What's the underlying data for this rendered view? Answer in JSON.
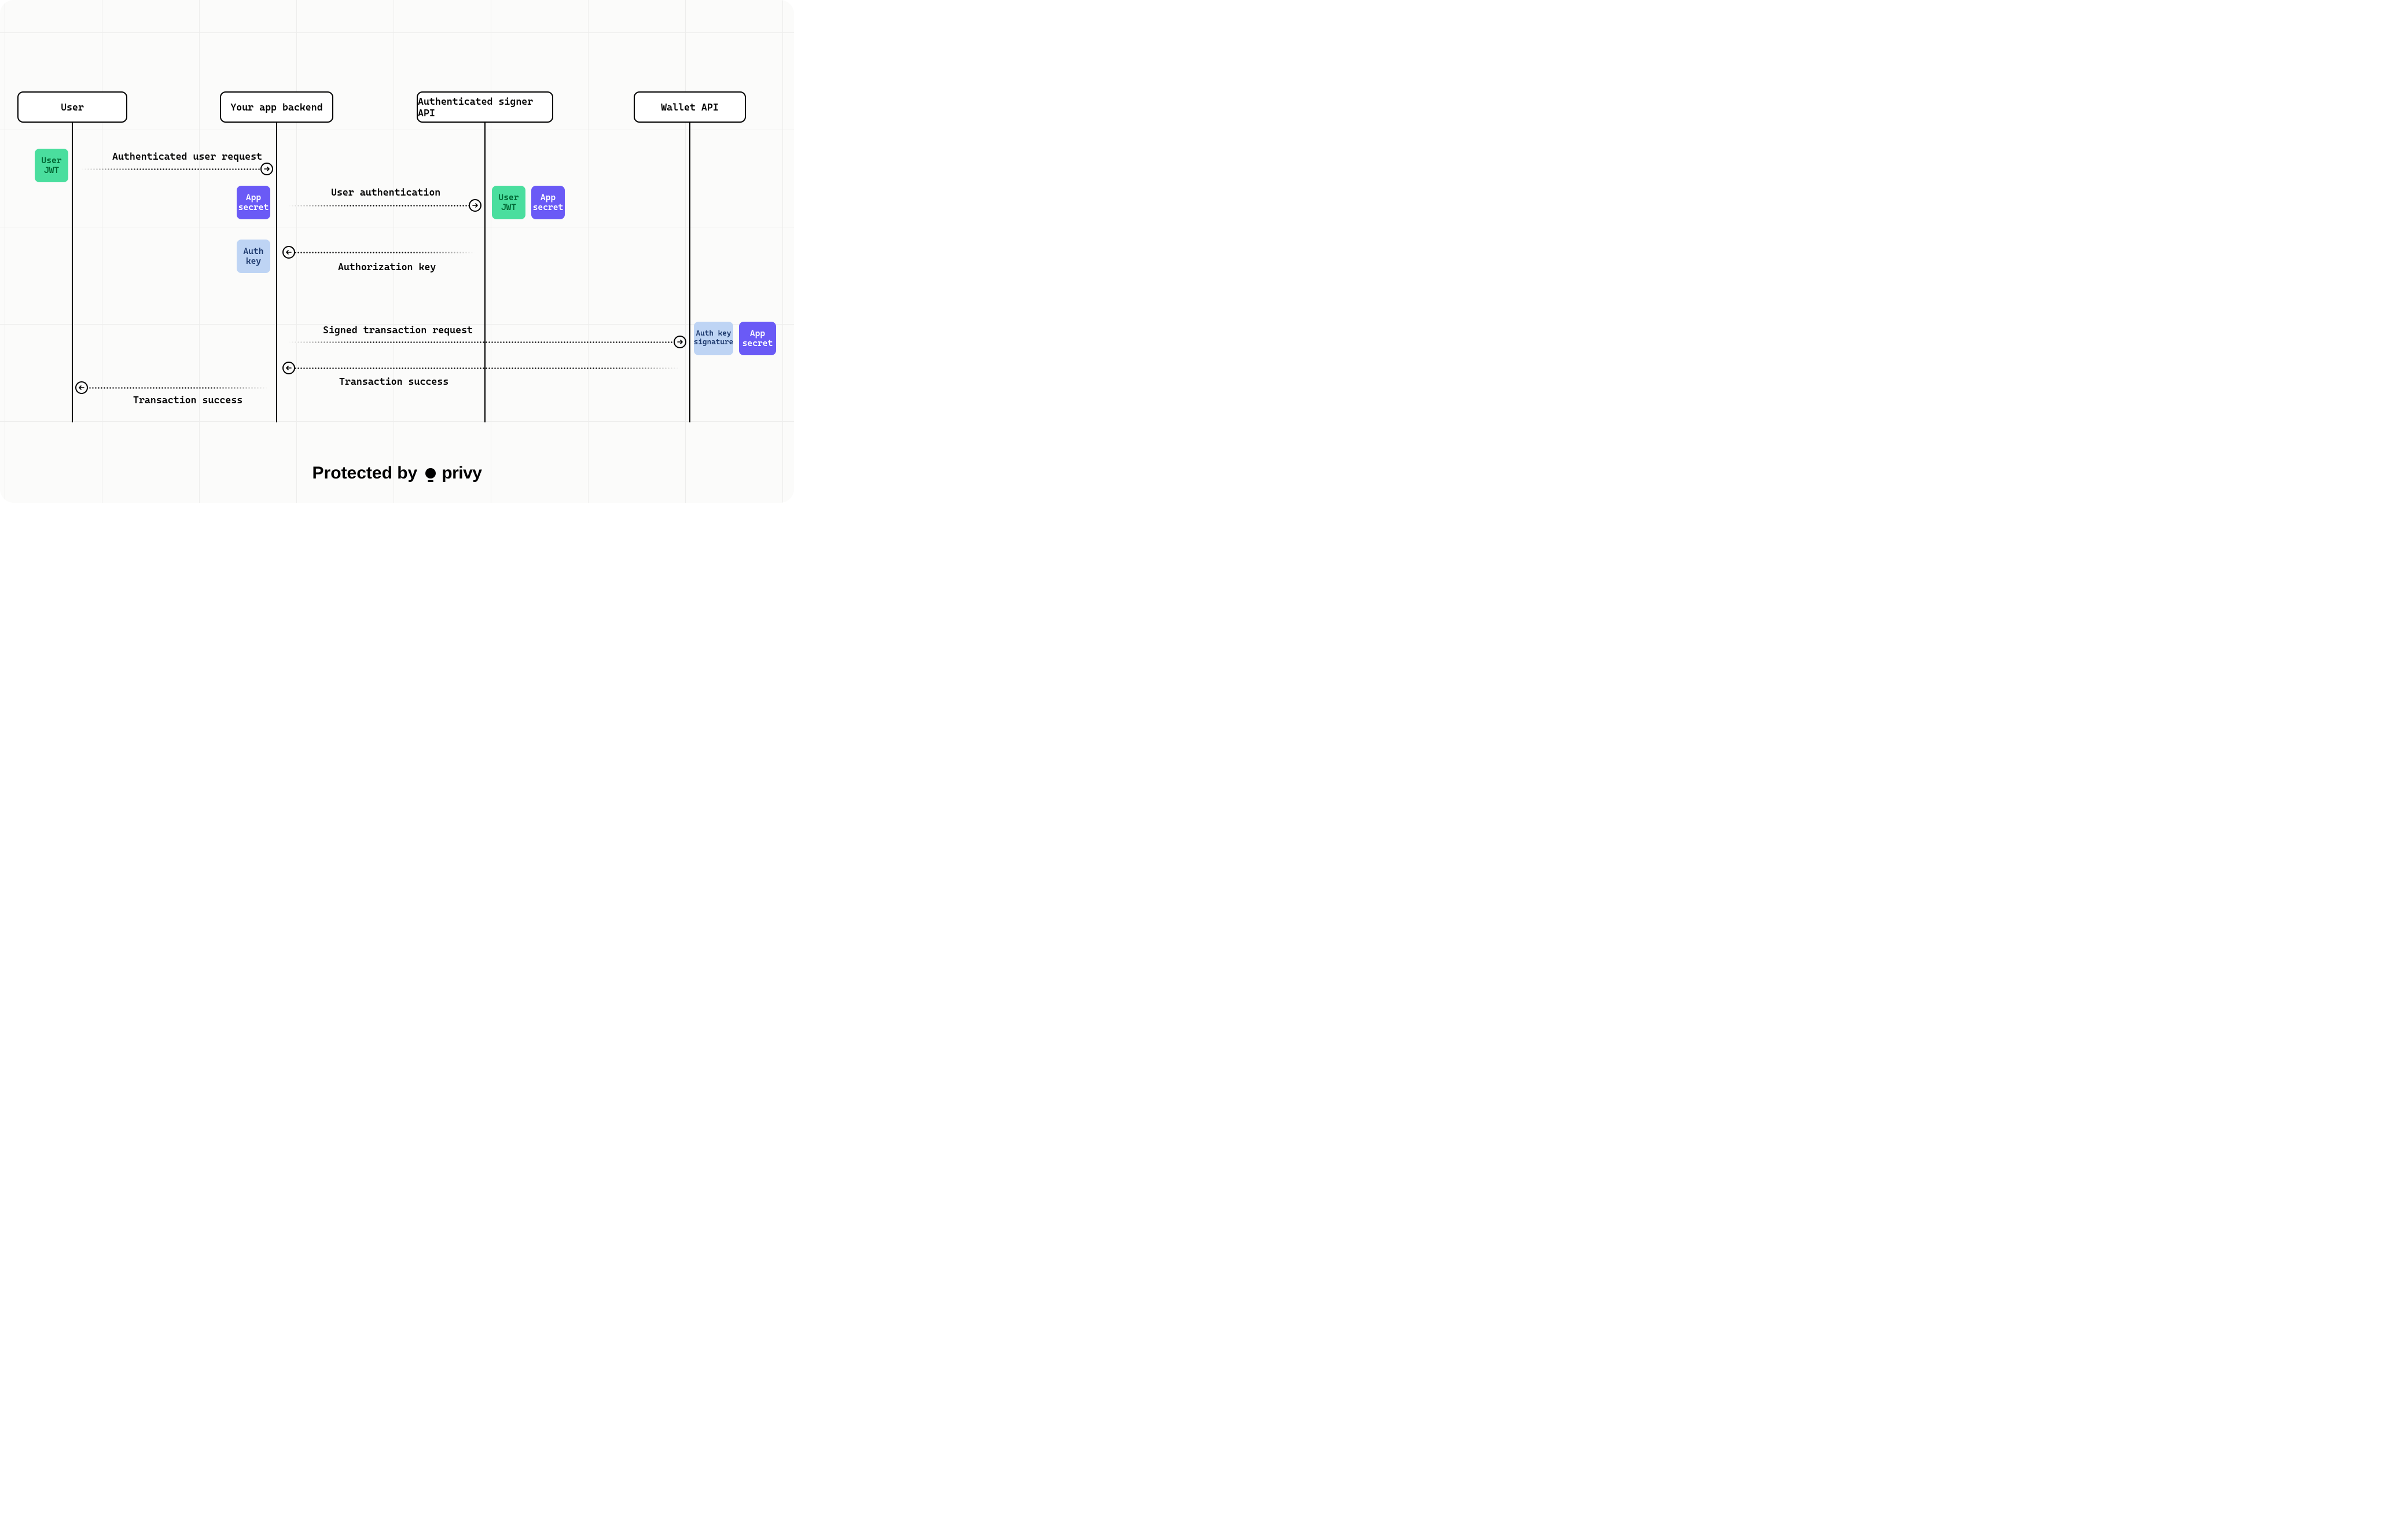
{
  "participants": {
    "user": "User",
    "backend": "Your app backend",
    "signer": "Authenticated signer API",
    "wallet": "Wallet API"
  },
  "messages": {
    "m1": "Authenticated user request",
    "m2": "User authentication",
    "m3": "Authorization key",
    "m4": "Signed transaction request",
    "m5": "Transaction success",
    "m6": "Transaction success"
  },
  "tokens": {
    "user_jwt": "User\nJWT",
    "app_secret": "App\nsecret",
    "auth_key": "Auth\nkey",
    "auth_key_sig": "Auth key\nsignature"
  },
  "footer": {
    "text": "Protected by",
    "brand": "privy"
  },
  "layout": {
    "lanes": {
      "user": 125,
      "backend": 478,
      "signer": 838,
      "wallet": 1192
    }
  }
}
